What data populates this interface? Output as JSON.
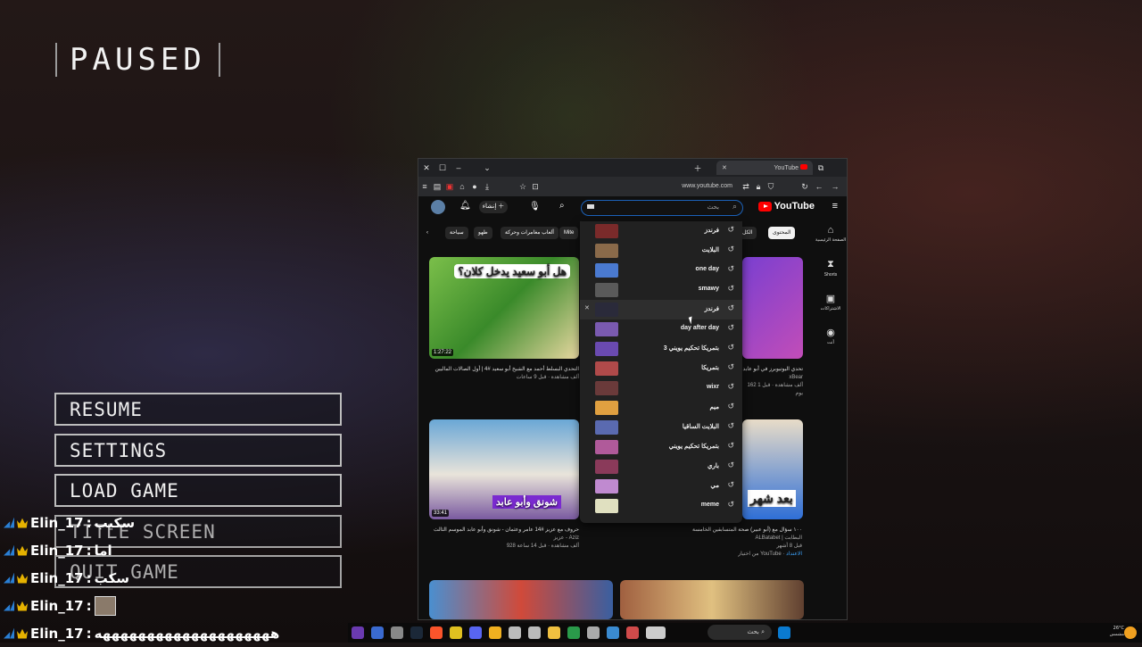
{
  "game": {
    "paused_label": "PAUSED",
    "menu": [
      "RESUME",
      "SETTINGS",
      "LOAD GAME",
      "TITLE SCREEN",
      "QUIT GAME"
    ]
  },
  "chat": [
    {
      "user": "Elin_17",
      "message": "سكيب"
    },
    {
      "user": "Elin_17",
      "message": "اما"
    },
    {
      "user": "Elin_17",
      "message": "سكب"
    },
    {
      "user": "Elin_17",
      "message": ""
    },
    {
      "user": "Elin_17",
      "message": "ههههههههههههههههههههه"
    }
  ],
  "browser": {
    "tab_title": "YouTube",
    "url": "www.youtube.com"
  },
  "youtube": {
    "logo": "YouTube",
    "create_label": "إنشاء",
    "search_placeholder": "بحث",
    "chips": [
      "الكل",
      "المحتوى",
      "ألعاب مغامرات وحركة",
      "طهو",
      "سياحة",
      "Mite"
    ],
    "sidebar": [
      {
        "icon": "home-icon",
        "label": "الصفحة الرئيسية"
      },
      {
        "icon": "shorts-icon",
        "label": "Shorts"
      },
      {
        "icon": "subscriptions-icon",
        "label": "الاشتراكات"
      },
      {
        "icon": "you-icon",
        "label": "أنت"
      }
    ],
    "suggestions": [
      {
        "text": "فرندز",
        "color": "#7a2a2a"
      },
      {
        "text": "البلايت",
        "color": "#8a6a4a"
      },
      {
        "text": "one day",
        "color": "#4a7ad0"
      },
      {
        "text": "smawy",
        "color": "#5a5a5a"
      },
      {
        "text": "فرندز",
        "color": "#2a2a3a"
      },
      {
        "text": "day after day",
        "color": "#7a5ab0"
      },
      {
        "text": "بتمريكا تحكيم يويني 3",
        "color": "#6a4ab0"
      },
      {
        "text": "بتمريكا",
        "color": "#b04a4a"
      },
      {
        "text": "wixr",
        "color": "#6a3a3a"
      },
      {
        "text": "ميم",
        "color": "#e0a040"
      },
      {
        "text": "البلايت الساقيا",
        "color": "#5a6ab0"
      },
      {
        "text": "بتمريكا تحكيم يويني",
        "color": "#b05a9a"
      },
      {
        "text": "باري",
        "color": "#8a3a5a"
      },
      {
        "text": "مي",
        "color": "#c08ad0"
      },
      {
        "text": "meme",
        "color": "#e0e0c0"
      }
    ],
    "videos": [
      {
        "overlay": "هل أبو سعيد يدخل كلان؟",
        "duration": "1:27:22",
        "title": "التحدي البسلط أحمد مع الشيخ أبو سعيد #4 | أول الصالات الماليين",
        "views": "ألف مشاهدة · قبل 9 ساعات"
      },
      {
        "overlay": "",
        "duration": "",
        "title": "تحدي اليوتيوبرز في أبو عابد",
        "channel": "xBear",
        "views": "162 ألف مشاهدة · قبل 1 يوم"
      },
      {
        "overlay": "شونق وأبو عابد",
        "duration": "33:41",
        "title": "حروف مع عزيز #14 عامر وعثمان - شونق وأبو عابد الموسم الثالث",
        "channel": "عزيز - Aziz",
        "views": "928 ألف مشاهدة · قبل 14 ساعة"
      },
      {
        "overlay": "بعد شهر",
        "duration": "",
        "title": "١٠٠ سؤال مع (أبو عبير) صحة المتسابقين الخامسة",
        "channel": "ALBatabet | البطابت",
        "views": "قبل 8 أشهر"
      }
    ],
    "video3_sub": "من اختيار YouTube",
    "video3_badge": "الاعتداد"
  },
  "taskbar": {
    "search_label": "بحث",
    "weather": "26°C",
    "weather_sub": "مشمس"
  },
  "colors": {
    "accent": "#ff0000",
    "search_border": "#1c62b9"
  }
}
